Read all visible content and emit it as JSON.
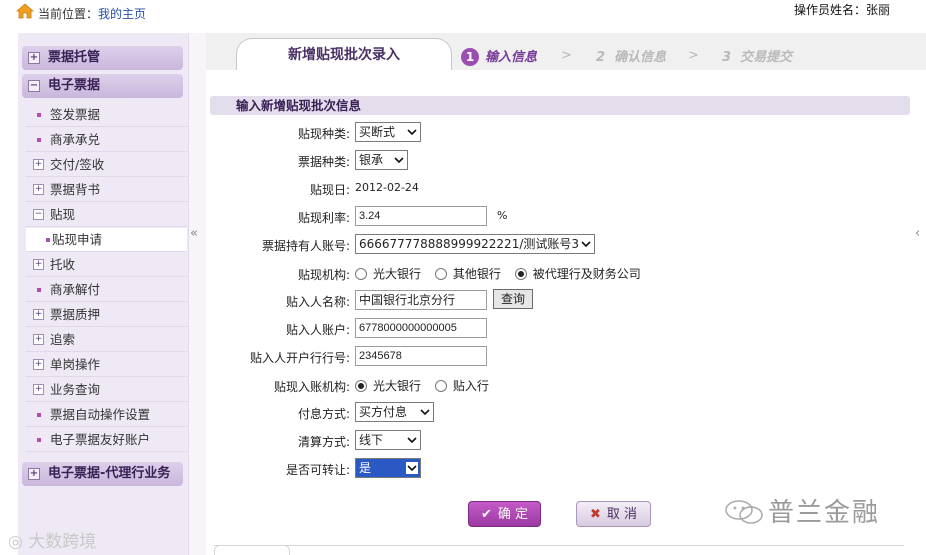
{
  "header": {
    "breadcrumb_prefix": "当前位置：",
    "breadcrumb_link": "我的主页",
    "operator": "操作员姓名：张丽"
  },
  "sidebar": {
    "groups": [
      {
        "label": "票据托管",
        "state": "collapsed"
      },
      {
        "label": "电子票据",
        "state": "expanded"
      }
    ],
    "items": [
      {
        "label": "签发票据",
        "type": "leaf"
      },
      {
        "label": "商承承兑",
        "type": "leaf"
      },
      {
        "label": "交付/签收",
        "type": "folder"
      },
      {
        "label": "票据背书",
        "type": "folder"
      },
      {
        "label": "贴现",
        "type": "folder-open"
      },
      {
        "label": "贴现申请",
        "type": "leaf",
        "active": true
      },
      {
        "label": "托收",
        "type": "folder"
      },
      {
        "label": "商承解付",
        "type": "leaf"
      },
      {
        "label": "票据质押",
        "type": "folder"
      },
      {
        "label": "追索",
        "type": "folder"
      },
      {
        "label": "单岗操作",
        "type": "folder"
      },
      {
        "label": "业务查询",
        "type": "folder"
      },
      {
        "label": "票据自动操作设置",
        "type": "leaf"
      },
      {
        "label": "电子票据友好账户",
        "type": "leaf"
      }
    ],
    "bottom_group": "电子票据-代理行业务"
  },
  "tabs": {
    "active": "新增贴现批次录入",
    "steps": [
      {
        "num": "1",
        "label": "输入信息"
      },
      {
        "num": "2",
        "label": "确认信息"
      },
      {
        "num": "3",
        "label": "交易提交"
      }
    ],
    "separator": ">"
  },
  "form": {
    "section_title": "输入新增贴现批次信息",
    "discount_type_label": "贴现种类:",
    "discount_type_value": "买断式",
    "bill_type_label": "票据种类:",
    "bill_type_value": "银承",
    "discount_date_label": "贴现日:",
    "discount_date_value": "2012-02-24",
    "rate_label": "贴现利率:",
    "rate_value": "3.24",
    "rate_unit": "%",
    "holder_account_label": "票据持有人账号:",
    "holder_account_value": "666677778888999922221/测试账号3",
    "institution_label": "贴现机构:",
    "institution_options": [
      "光大银行",
      "其他银行",
      "被代理行及财务公司"
    ],
    "institution_selected": 2,
    "buyer_name_label": "贴入人名称:",
    "buyer_name_value": "中国银行北京分行",
    "query_button": "查询",
    "buyer_account_label": "贴入人账户:",
    "buyer_account_value": "6778000000000005",
    "buyer_bank_label": "贴入人开户行行号:",
    "buyer_bank_value": "2345678",
    "entry_institution_label": "贴现入账机构:",
    "entry_options": [
      "光大银行",
      "贴入行"
    ],
    "entry_selected": 0,
    "interest_label": "付息方式:",
    "interest_value": "买方付息",
    "clearing_label": "清算方式:",
    "clearing_value": "线下",
    "transferable_label": "是否可转让:",
    "transferable_value": "是"
  },
  "actions": {
    "ok_label": "确 定",
    "cancel_label": "取 消"
  },
  "watermarks": {
    "right": "普兰金融",
    "left": "大数跨境"
  },
  "colors": {
    "accent": "#9a4fb0",
    "section_bg": "#e4deec",
    "sidebar_bg": "#efe9f5",
    "highlight": "#2a59c4"
  }
}
